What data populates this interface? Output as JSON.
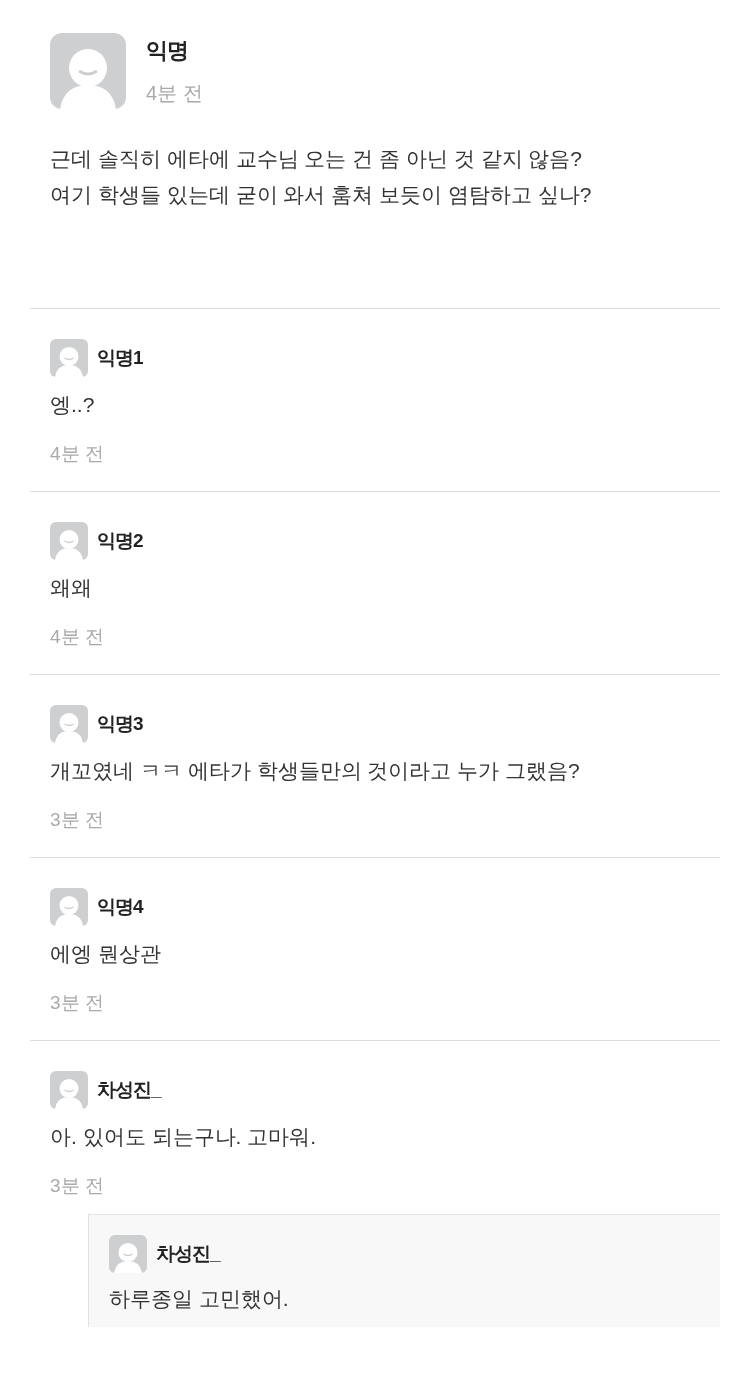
{
  "post": {
    "author": "익명",
    "time": "4분 전",
    "body": "근데 솔직히 에타에 교수님 오는 건 좀 아닌 것 같지 않음?\n여기 학생들 있는데 굳이 와서 훔쳐 보듯이 염탐하고 싶나?"
  },
  "comments": [
    {
      "author": "익명1",
      "text": "엥..?",
      "time": "4분 전"
    },
    {
      "author": "익명2",
      "text": "왜왜",
      "time": "4분 전"
    },
    {
      "author": "익명3",
      "text": "개꼬였네 ㅋㅋ 에타가 학생들만의 것이라고 누가 그랬음?",
      "time": "3분 전"
    },
    {
      "author": "익명4",
      "text": "에엥 뭔상관",
      "time": "3분 전"
    },
    {
      "author": "차성진_",
      "text": "아. 있어도 되는구나. 고마워.",
      "time": "3분 전",
      "replies": [
        {
          "author": "차성진_",
          "text": "하루종일 고민했어."
        }
      ]
    }
  ]
}
